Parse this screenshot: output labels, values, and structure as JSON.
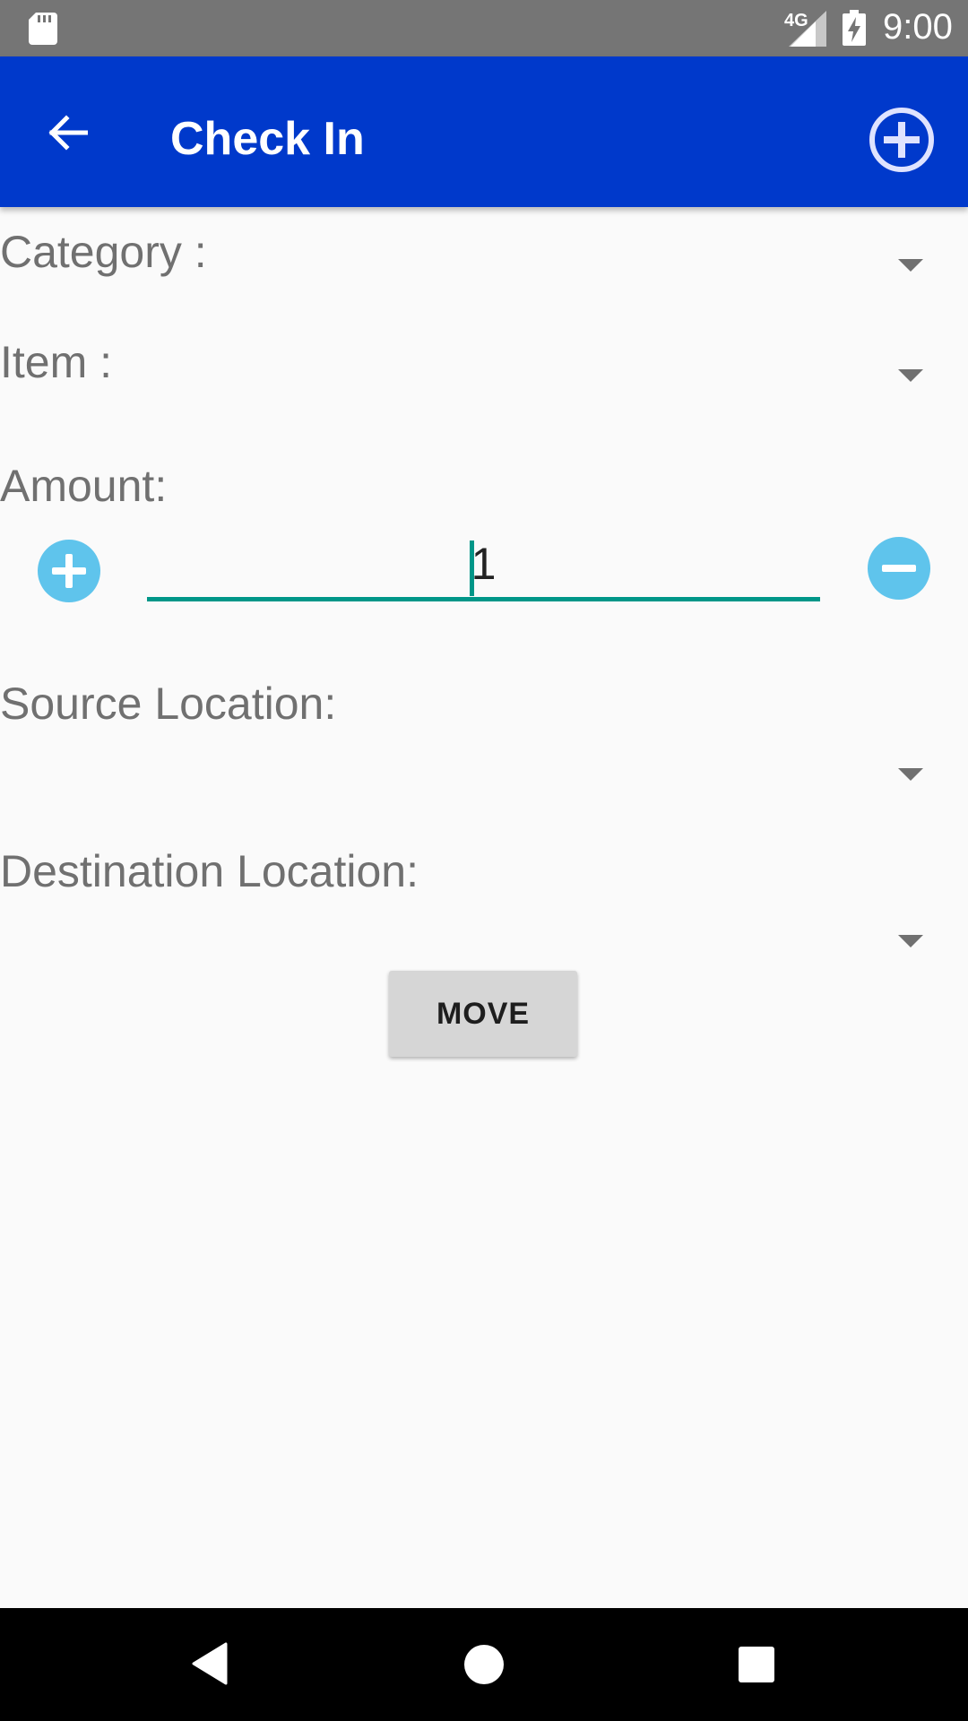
{
  "status_bar": {
    "network": "4G",
    "time": "9:00",
    "icons": [
      "sd-card-icon",
      "signal-icon",
      "battery-charging-icon"
    ]
  },
  "app_bar": {
    "title": "Check In",
    "icons": [
      "back-arrow-icon",
      "add-circle-icon"
    ],
    "color": "#0039cb"
  },
  "form": {
    "category_label": "Category :",
    "item_label": "Item :",
    "amount_label": "Amount:",
    "amount_value": "1",
    "source_label": "Source Location:",
    "destination_label": "Destination Location:",
    "move_label": "MOVE",
    "accent_color": "#009688",
    "stepper_color": "#5fc4ec"
  },
  "nav_bar": {
    "icons": [
      "nav-back-icon",
      "nav-home-icon",
      "nav-recents-icon"
    ]
  }
}
